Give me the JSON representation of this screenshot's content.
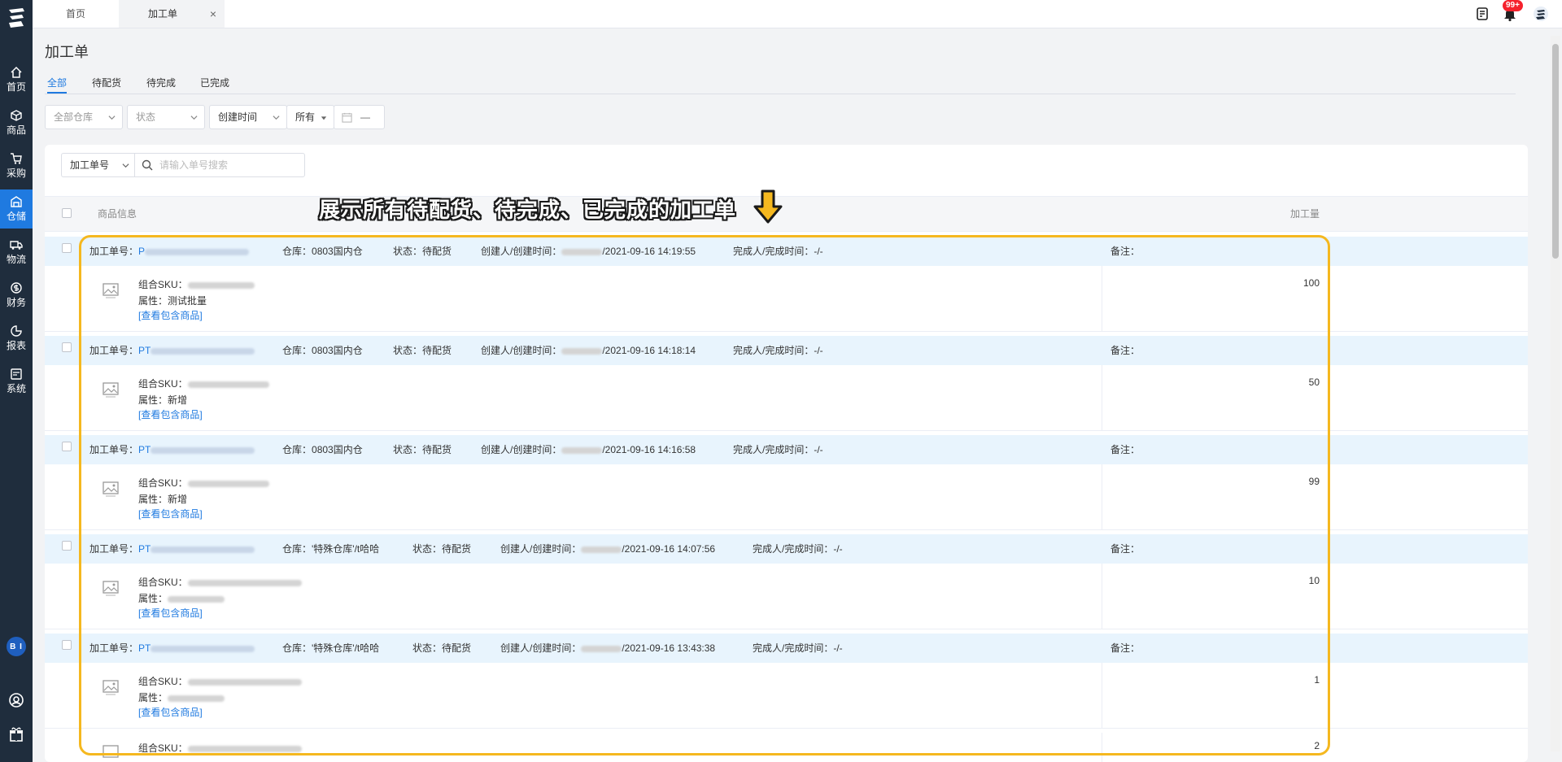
{
  "sidebar": {
    "items": [
      {
        "label": "首页",
        "icon": "home-icon"
      },
      {
        "label": "商品",
        "icon": "box-icon"
      },
      {
        "label": "采购",
        "icon": "cart-icon"
      },
      {
        "label": "仓储",
        "icon": "warehouse-icon"
      },
      {
        "label": "物流",
        "icon": "truck-icon"
      },
      {
        "label": "财务",
        "icon": "money-icon"
      },
      {
        "label": "报表",
        "icon": "chart-icon"
      },
      {
        "label": "系统",
        "icon": "system-icon"
      }
    ],
    "avatar_text": "B I"
  },
  "topbar": {
    "tabs": [
      {
        "label": "首页"
      },
      {
        "label": "加工单",
        "close": "×"
      }
    ],
    "badge": "99+"
  },
  "page": {
    "title": "加工单",
    "subtabs": [
      "全部",
      "待配货",
      "待完成",
      "已完成"
    ],
    "filters": {
      "warehouse": "全部仓库",
      "status": "状态",
      "time_type": "创建时间",
      "range": "所有",
      "date_dash": "—"
    }
  },
  "search": {
    "select": "加工单号",
    "placeholder": "请输入单号搜索"
  },
  "table": {
    "col_product": "商品信息",
    "col_qty": "加工量"
  },
  "labels": {
    "order_no": "加工单号：",
    "warehouse": "仓库：",
    "status": "状态：",
    "creator": "创建人/创建时间：",
    "finisher": "完成人/完成时间：",
    "finisher_value": "-/-",
    "remark": "备注：",
    "sku": "组合SKU：",
    "attr": "属性：",
    "view_link": "[查看包含商品]"
  },
  "orders": [
    {
      "no_prefix": "P",
      "warehouse": "0803国内仓",
      "status": "待配货",
      "created": "/2021-09-16 14:19:55",
      "attr": "测试批量",
      "qty": "100"
    },
    {
      "no_prefix": "PT",
      "warehouse": "0803国内仓",
      "status": "待配货",
      "created": "/2021-09-16 14:18:14",
      "attr": "新增",
      "qty": "50"
    },
    {
      "no_prefix": "PT",
      "warehouse": "0803国内仓",
      "status": "待配货",
      "created": "/2021-09-16 14:16:58",
      "attr": "新增",
      "qty": "99"
    },
    {
      "no_prefix": "PT",
      "warehouse": "'特殊仓库'/t哈哈",
      "status": "待配货",
      "created": "/2021-09-16 14:07:56",
      "attr": "",
      "qty": "10"
    },
    {
      "no_prefix": "PT",
      "warehouse": "'特殊仓库'/t哈哈",
      "status": "待配货",
      "created": "/2021-09-16 13:43:38",
      "attr": "",
      "qty": "1"
    }
  ],
  "extra_row": {
    "qty": "2"
  },
  "annotation": {
    "text": "展示所有待配货、待完成、已完成的加工单",
    "color": "#f5b81f"
  }
}
